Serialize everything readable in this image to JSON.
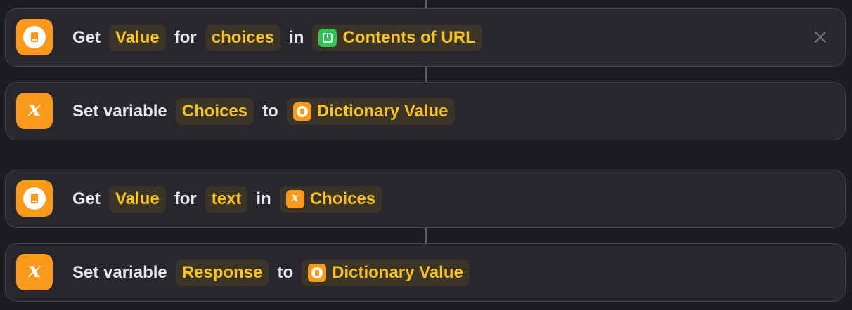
{
  "actions": [
    {
      "kind": "get-dictionary-value",
      "icon": "dictionary-book-icon",
      "verb": "Get",
      "key_token": "Value",
      "for_word": "for",
      "field_token": "choices",
      "in_word": "in",
      "source": {
        "icon": "download-icon",
        "label": "Contents of URL"
      },
      "has_close": true
    },
    {
      "kind": "set-variable",
      "icon": "variable-x-icon",
      "verb": "Set variable",
      "name_token": "Choices",
      "to_word": "to",
      "source": {
        "icon": "dictionary-icon",
        "label": "Dictionary Value"
      }
    },
    {
      "kind": "get-dictionary-value",
      "icon": "dictionary-book-icon",
      "verb": "Get",
      "key_token": "Value",
      "for_word": "for",
      "field_token": "text",
      "in_word": "in",
      "source": {
        "icon": "variable-x-icon",
        "label": "Choices"
      }
    },
    {
      "kind": "set-variable",
      "icon": "variable-x-icon",
      "verb": "Set variable",
      "name_token": "Response",
      "to_word": "to",
      "source": {
        "icon": "dictionary-icon",
        "label": "Dictionary Value"
      }
    }
  ],
  "close_glyph": "✕",
  "colors": {
    "background": "#1e1b22",
    "card": "#2a262e",
    "card_border": "#45414b",
    "accent_orange": "#fb9a1a",
    "token_text": "#fcc21f",
    "token_bg": "#3a3429",
    "url_green": "#2fc556"
  }
}
